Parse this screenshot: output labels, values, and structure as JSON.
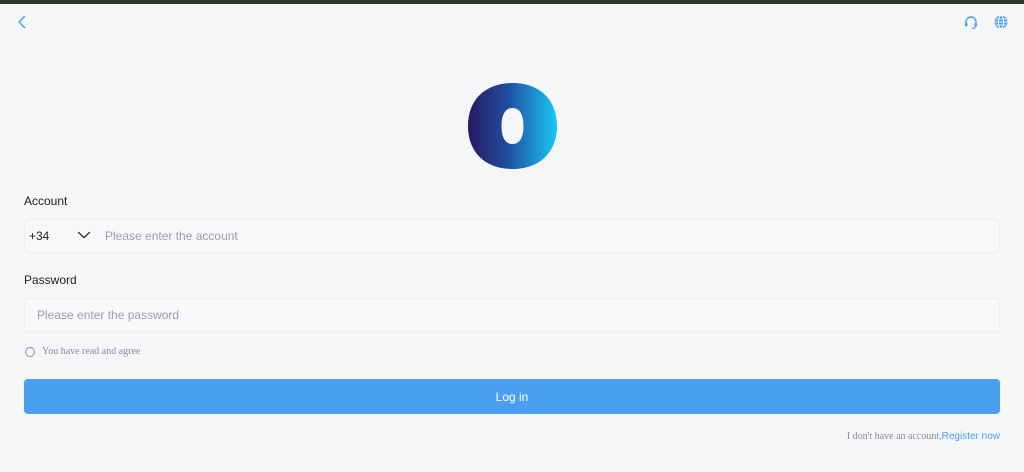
{
  "header": {
    "back_icon": "chevron-left-icon",
    "support_icon": "headset-icon",
    "language_icon": "globe-icon"
  },
  "logo": {
    "icon": "o-logo-icon",
    "gradient_start": "#2a1760",
    "gradient_end": "#1ac8f5"
  },
  "account": {
    "label": "Account",
    "country_code": "+34",
    "placeholder": "Please enter the account",
    "value": ""
  },
  "password": {
    "label": "Password",
    "placeholder": "Please enter the password",
    "value": ""
  },
  "agreement": {
    "text": "You have read and agree",
    "checked": false
  },
  "login_button": {
    "label": "Log in",
    "color": "#4a9ff0"
  },
  "register": {
    "prompt": "I don't have an account,",
    "link": "Register now",
    "link_color": "#4a9ff0"
  }
}
